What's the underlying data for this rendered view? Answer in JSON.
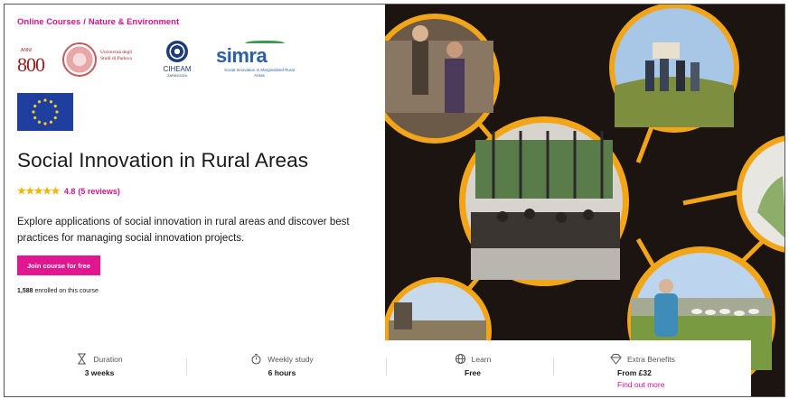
{
  "breadcrumb": {
    "item1": "Online Courses",
    "separator": "/",
    "item2": "Nature & Environment"
  },
  "logos": {
    "padova800_small": "ANNI",
    "padova800_big": "800",
    "padova_text": "Università degli Studi di Padova",
    "ciheam_name": "CIHEAM",
    "ciheam_sub": "ZARAGOZA",
    "simra_word": "simra",
    "simra_tag": "Social Innovation in Marginalised Rural Areas"
  },
  "course": {
    "title": "Social Innovation in Rural Areas",
    "stars": "★★★★★",
    "rating": "4.8",
    "reviews": "(5 reviews)",
    "description": "Explore applications of social innovation in rural areas and discover best practices for managing social innovation projects.",
    "join_label": "Join course for free",
    "enrolled_count": "1,588",
    "enrolled_text": "enrolled on this course"
  },
  "stats": {
    "duration_label": "Duration",
    "duration_value": "3 weeks",
    "weekly_label": "Weekly study",
    "weekly_value": "6 hours",
    "learn_label": "Learn",
    "learn_value": "Free",
    "benefits_label": "Extra Benefits",
    "benefits_value": "From £32",
    "benefits_link": "Find out more"
  },
  "colors": {
    "accent": "#e2168f",
    "star": "#f2b705",
    "hero_bg": "#1b1410",
    "ring": "#f2a516"
  }
}
